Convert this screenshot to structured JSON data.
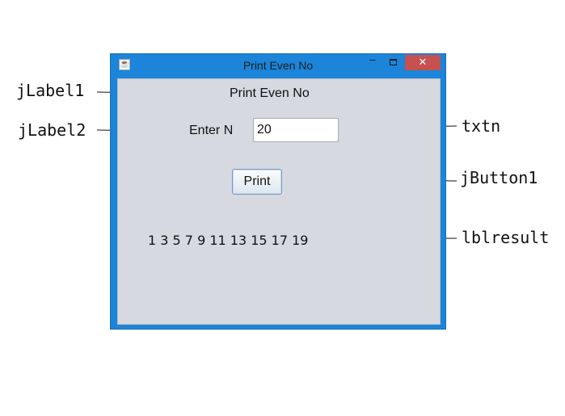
{
  "window": {
    "title": "Print Even No",
    "minimize_glyph": "–",
    "close_glyph": "✕",
    "app_icon": "java-icon"
  },
  "form": {
    "heading": "Print Even No",
    "enter_label": "Enter N",
    "input_value": "20",
    "button_label": "Print",
    "result": "1 3 5 7 9 11 13 15 17 19"
  },
  "callouts": {
    "jlabel1": "jLabel1",
    "jlabel2": "jLabel2",
    "txtn": "txtn",
    "jbutton1": "jButton1",
    "lblresult": "lblresult"
  }
}
